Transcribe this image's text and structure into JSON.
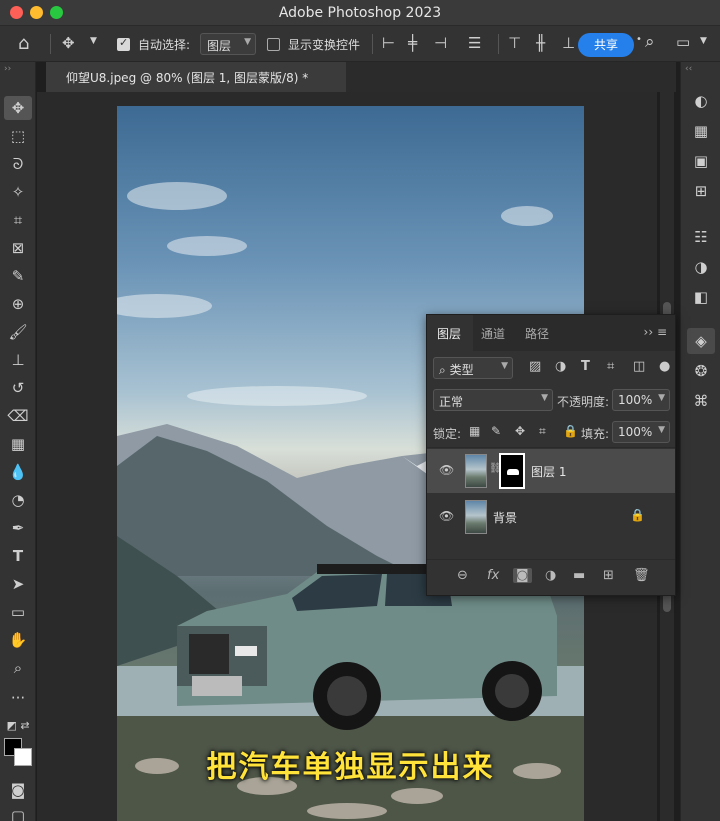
{
  "window": {
    "title": "Adobe Photoshop 2023"
  },
  "options_bar": {
    "auto_select_label": "自动选择:",
    "auto_select_value": "图层",
    "show_transform_label": "显示变换控件",
    "share_label": "共享"
  },
  "document": {
    "tab_title": "仰望U8.jpeg @ 80% (图层 1, 图层蒙版/8) *"
  },
  "canvas": {
    "caption": "把汽车单独显示出来"
  },
  "layers_panel": {
    "tabs": [
      "图层",
      "通道",
      "路径"
    ],
    "filter_label": "类型",
    "blend_mode": "正常",
    "opacity_label": "不透明度:",
    "opacity_value": "100%",
    "lock_label": "锁定:",
    "fill_label": "填充:",
    "fill_value": "100%",
    "layers": [
      {
        "name": "图层 1",
        "selected": true,
        "has_mask": true,
        "locked": false
      },
      {
        "name": "背景",
        "selected": false,
        "has_mask": false,
        "locked": true
      }
    ]
  },
  "colors": {
    "accent": "#2680eb",
    "caption": "#ffe23a"
  }
}
